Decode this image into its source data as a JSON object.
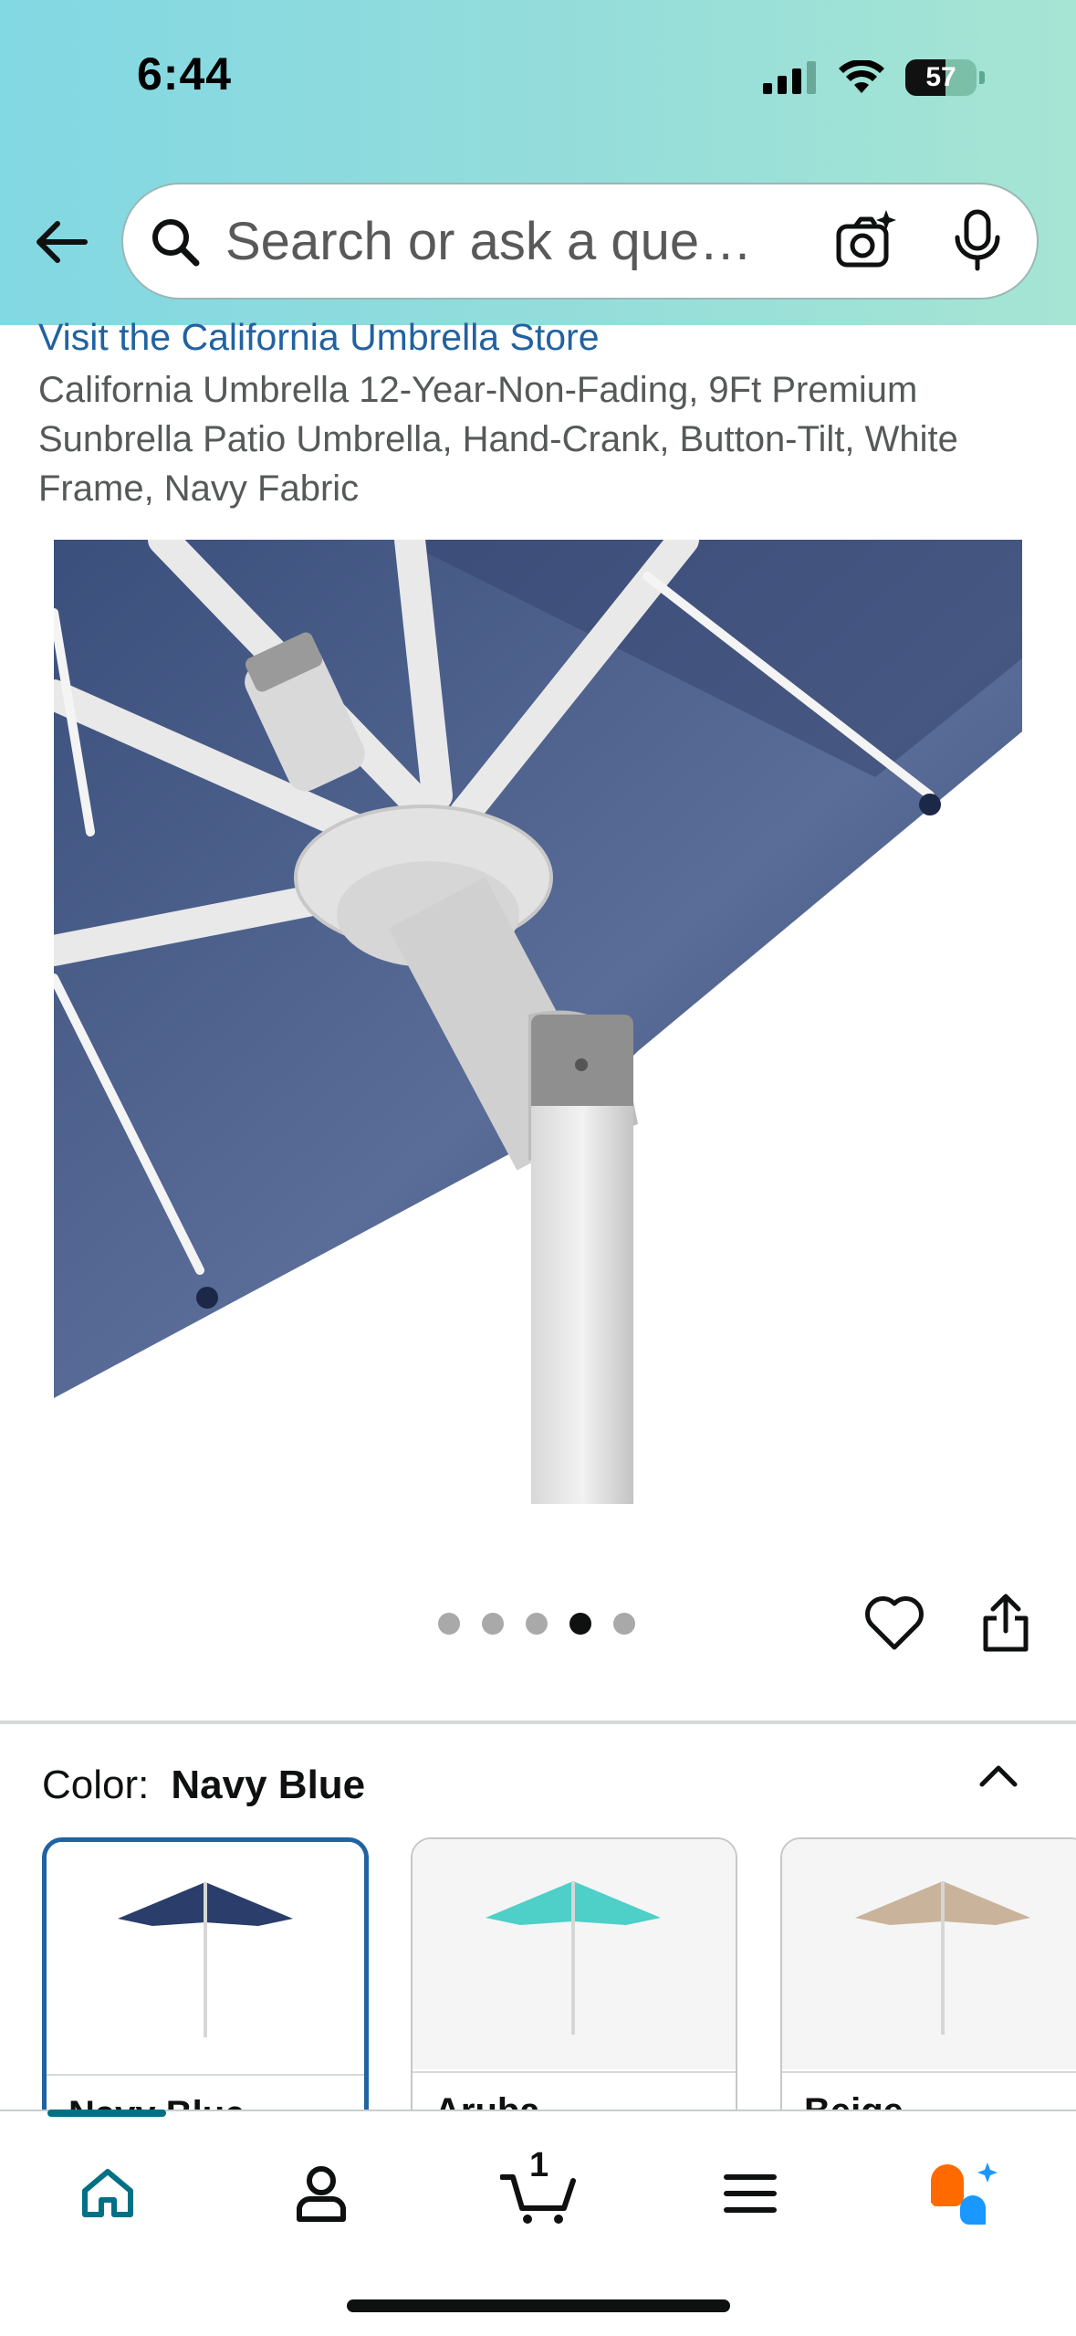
{
  "status_bar": {
    "time": "6:44",
    "battery": "57"
  },
  "search": {
    "placeholder": "Search or ask a que…"
  },
  "product": {
    "store_link": "Visit the California Umbrella Store",
    "title": "California Umbrella 12-Year-Non-Fading, 9Ft Premium Sunbrella Patio Umbrella, Hand-Crank, Button-Tilt, White Frame, Navy Fabric",
    "image_pager": {
      "count": 5,
      "active_index": 4
    }
  },
  "color_selector": {
    "label": "Color:",
    "selected": "Navy Blue",
    "options": [
      {
        "label": "Navy Blue",
        "canopy_color": "#2a3d6b"
      },
      {
        "label": "Aruba",
        "canopy_color": "#4ecfc8"
      },
      {
        "label": "Beige",
        "canopy_color": "#c9b39a"
      }
    ]
  },
  "bottom_nav": {
    "items": [
      {
        "icon": "home-icon"
      },
      {
        "icon": "account-icon"
      },
      {
        "icon": "cart-icon"
      },
      {
        "icon": "menu-icon"
      },
      {
        "icon": "rufus-assistant-icon"
      }
    ],
    "cart_count": "1"
  },
  "colors": {
    "link": "#2162a1",
    "accent_teal": "#007185",
    "selected_border": "#2162a1"
  }
}
